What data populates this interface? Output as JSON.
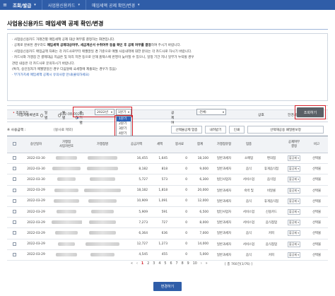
{
  "nav": {
    "menu_icon": "hamburger-icon",
    "main": "조회/발급",
    "crumb1": "사업용신용카드",
    "crumb2": "매입세액 공제 확인/변경"
  },
  "page": {
    "title": "사업용신용카드 매입세액 공제 확인/변경"
  },
  "notice": {
    "l1": "· 사업용신용카드 거래건별 매입세액 공제 대상 여부를 결정하는 화면입니다.",
    "l2a": "· 공제로 분류된 경우라도",
    "l2b": "매입세액 공제대상여부, 세금계산서 수취여부 등을 확인 후 공제 여부를 결정",
    "l2c": "하여 주시기 바랍니다.",
    "l3": "· 사업용신용카드 매입금액 자료는 각 카드사로부터 매월말일 경 기준으로 매월 사용내역에 대한 분의는 각 카드사로 하시기 바랍니다.",
    "l4": "· 카드사와 가맹점 간 결제대금 지급은 및 처리 지연 등으로 인해 홈택스에 반영이 늦어질 수 있으니, 일정 기간 지나 일부가 누락될 경우",
    "l5": "  관련 내용은 각 카드사로 문의하시기 바랍니다.",
    "l6": "  (특히, 승인일자가 매월말일인 경우 다음달에 국세청에 제출되는 경우가 있음)",
    "link": "· 부가가치세 매입세액 공제시 유의사항 안내(클릭하세요)"
  },
  "biz": {
    "reg_label": "사업자등록번호",
    "reg_value": "632-08-00201",
    "name_label": "상호",
    "name_value": "한경세무회계"
  },
  "search": {
    "period_label": "조회기간",
    "opt_day": "일별",
    "opt_month": "월별",
    "opt_quarter": "분기별",
    "year": "2022년",
    "quarter": "1분기",
    "quarter_options": [
      "1분기",
      "2분기",
      "3분기",
      "4분기"
    ],
    "deduct_label": "공제여부",
    "deduct_value": "-전체-",
    "search_button": "조회하기"
  },
  "list": {
    "usage_label": "※ 사용금액 :",
    "usage_note": "(봉사료 제외)",
    "btn1": "선택불공제 업종",
    "btn2": "내려받기",
    "btn3": "인쇄",
    "btn4": "선택재공용 패밀렌보정"
  },
  "table": {
    "headers": [
      "",
      "승인일자",
      "가맹점\n사업자번호",
      "가맹점명",
      "공급가액",
      "세액",
      "봉사료",
      "합계",
      "가맹점유형",
      "업종",
      "공제여부\n결정",
      "비고"
    ],
    "rows": [
      {
        "date": "2022-03-30",
        "supply": "16,455",
        "tax": "1,645",
        "svc": "0",
        "total": "18,100",
        "type": "일반과세자",
        "biz": "소매업",
        "item": "편의점",
        "deduct": "불공제",
        "note": "선택불"
      },
      {
        "date": "2022-03-30",
        "supply": "8,182",
        "tax": "818",
        "svc": "0",
        "total": "9,000",
        "type": "일반과세자",
        "biz": "음식",
        "item": "휴게음식점",
        "deduct": "불공제",
        "note": "선택불"
      },
      {
        "date": "2022-03-30",
        "supply": "5,727",
        "tax": "573",
        "svc": "0",
        "total": "6,300",
        "type": "법인사업자",
        "biz": "서비스업",
        "item": "음식업",
        "deduct": "불공제",
        "note": "선택불"
      },
      {
        "date": "2022-03-29",
        "supply": "18,182",
        "tax": "1,818",
        "svc": "0",
        "total": "20,000",
        "type": "일반과세자",
        "biz": "숙박 및",
        "item": "비알콜",
        "deduct": "불공제",
        "note": "선택불"
      },
      {
        "date": "2022-03-29",
        "supply": "10,909",
        "tax": "1,091",
        "svc": "0",
        "total": "12,000",
        "type": "일반과세자",
        "biz": "음식",
        "item": "휴게음식점",
        "deduct": "불공제",
        "note": "선택불"
      },
      {
        "date": "2022-03-29",
        "supply": "5,909",
        "tax": "591",
        "svc": "0",
        "total": "6,500",
        "type": "법인사업자",
        "biz": "서비스업",
        "item": "신용카드",
        "deduct": "불공제",
        "note": "선택불"
      },
      {
        "date": "2022-03-29",
        "supply": "7,273",
        "tax": "727",
        "svc": "0",
        "total": "8,000",
        "type": "일반과세자",
        "biz": "서비스업",
        "item": "음식점업",
        "deduct": "불공제",
        "note": "선택불"
      },
      {
        "date": "2022-03-29",
        "supply": "6,364",
        "tax": "636",
        "svc": "0",
        "total": "7,000",
        "type": "일반과세자",
        "biz": "음식",
        "item": "커피",
        "deduct": "불공제",
        "note": "선택불"
      },
      {
        "date": "2022-03-29",
        "supply": "12,727",
        "tax": "1,273",
        "svc": "0",
        "total": "14,000",
        "type": "일반과세자",
        "biz": "서비스업",
        "item": "음식점업",
        "deduct": "불공제",
        "note": "선택불"
      },
      {
        "date": "2022-03-29",
        "supply": "4,545",
        "tax": "455",
        "svc": "0",
        "total": "5,000",
        "type": "일반과세자",
        "biz": "음식",
        "item": "커피",
        "deduct": "불공제",
        "note": "선택불"
      }
    ]
  },
  "pager": {
    "pages": [
      "1",
      "2",
      "3",
      "4",
      "5",
      "6",
      "7",
      "8",
      "9",
      "10"
    ],
    "current": "1",
    "total": "[ 총 760건(1/76) ]"
  },
  "footer": {
    "change_button": "변경하기"
  }
}
